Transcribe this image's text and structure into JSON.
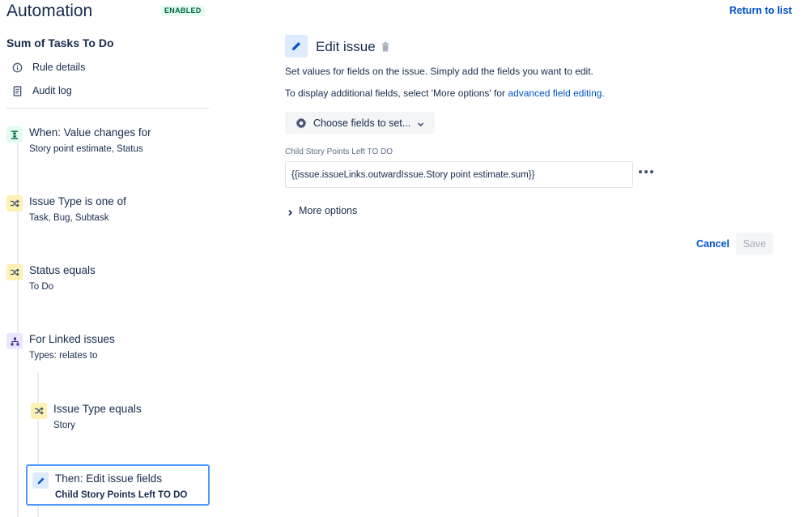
{
  "header": {
    "title": "Automation",
    "status_badge": "ENABLED",
    "return_link": "Return to list"
  },
  "sidebar": {
    "rule_name": "Sum of Tasks To Do",
    "links": [
      {
        "label": "Rule details",
        "icon": "info-icon"
      },
      {
        "label": "Audit log",
        "icon": "document-icon"
      }
    ],
    "steps": [
      {
        "type": "trigger",
        "icon": "trigger-icon",
        "title": "When: Value changes for",
        "subtitle": "Story point estimate, Status"
      },
      {
        "type": "condition",
        "icon": "condition-icon",
        "title": "Issue Type is one of",
        "subtitle": "Task, Bug, Subtask"
      },
      {
        "type": "condition",
        "icon": "condition-icon",
        "title": "Status equals",
        "subtitle": "To Do"
      },
      {
        "type": "branch",
        "icon": "branch-icon",
        "title": "For Linked issues",
        "subtitle": "Types: relates to"
      },
      {
        "type": "condition",
        "icon": "condition-icon",
        "title": "Issue Type equals",
        "subtitle": "Story"
      },
      {
        "type": "action",
        "icon": "pencil-icon",
        "title": "Then: Edit issue fields",
        "subtitle": "Child Story Points Left TO DO",
        "selected": true
      }
    ]
  },
  "panel": {
    "title": "Edit issue",
    "description_1": "Set values for fields on the issue. Simply add the fields you want to edit.",
    "description_2_prefix": "To display additional fields, select 'More options' for ",
    "description_2_link": "advanced field editing.",
    "choose_fields_label": "Choose fields to set...",
    "field_label": "Child Story Points Left TO DO",
    "field_value": "{{issue.issueLinks.outwardIssue.Story point estimate.sum}}",
    "more_options_label": "More options",
    "cancel_label": "Cancel",
    "save_label": "Save"
  },
  "colors": {
    "link": "#0052cc",
    "trigger_bg": "#e3fcef",
    "condition_bg": "#fff0b3",
    "branch_bg": "#eae6ff",
    "action_bg": "#deebff",
    "selected_border": "#4c9aff"
  }
}
